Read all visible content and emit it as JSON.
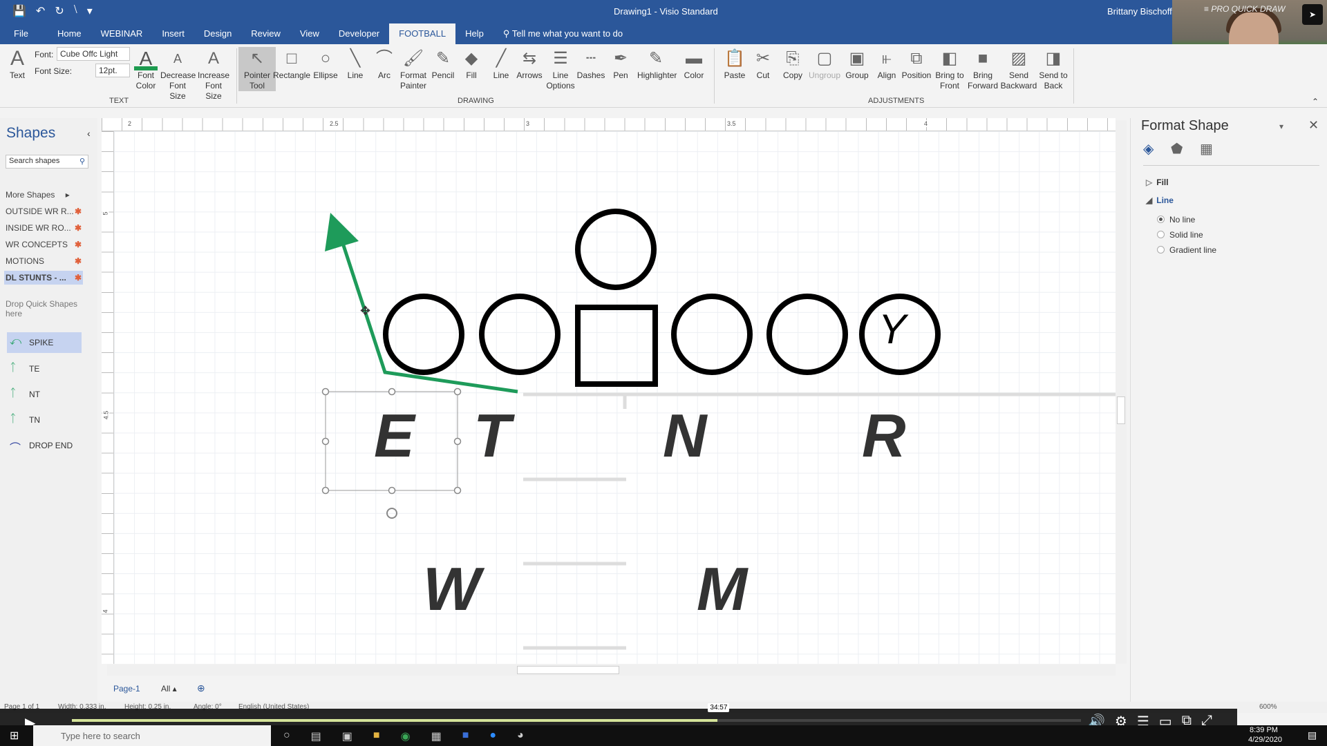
{
  "window": {
    "title": "Drawing1  -  Visio Standard",
    "user": "Brittany Bischoff"
  },
  "tabs": [
    "File",
    "Home",
    "WEBINAR",
    "Insert",
    "Design",
    "Review",
    "View",
    "Developer",
    "FOOTBALL",
    "Help"
  ],
  "active_tab": "FOOTBALL",
  "tell_me": "Tell me what you want to do",
  "ribbon": {
    "text_group": {
      "label": "TEXT",
      "text_btn": "Text",
      "font_label": "Font:",
      "font_value": "Cube Offc Light",
      "size_label": "Font Size:",
      "size_value": "12pt.",
      "font_color": "Font Color",
      "decrease": "Decrease Font Size",
      "increase": "Increase Font Size",
      "font_color_hex": "#1e9b50"
    },
    "drawing_group": {
      "label": "DRAWING",
      "buttons": [
        "Pointer Tool",
        "Rectangle",
        "Ellipse",
        "Line",
        "Arc",
        "Format Painter",
        "Pencil",
        "Fill",
        "Line",
        "Arrows",
        "Line Options",
        "Dashes",
        "Pen",
        "Highlighter",
        "Color"
      ]
    },
    "adjust_group": {
      "label": "ADJUSTMENTS",
      "buttons": [
        "Paste",
        "Cut",
        "Copy",
        "Ungroup",
        "Group",
        "Align",
        "Position",
        "Bring to Front",
        "Bring Forward",
        "Send Backward",
        "Send to Back"
      ]
    }
  },
  "webcam": {
    "logo": "PRO QUICK DRAW"
  },
  "shapes_panel": {
    "title": "Shapes",
    "search_placeholder": "Search shapes",
    "more": "More Shapes",
    "stencils": [
      "OUTSIDE WR R...",
      "INSIDE WR RO...",
      "WR CONCEPTS",
      "MOTIONS",
      "DL STUNTS - ..."
    ],
    "active_stencil": "DL STUNTS - ...",
    "drop_hint": "Drop Quick Shapes here",
    "quick_shapes": [
      "SPIKE",
      "TE",
      "NT",
      "TN",
      "DROP END"
    ],
    "selected_shape": "SPIKE"
  },
  "rulers": {
    "top": [
      "2",
      "2.5",
      "3",
      "3.5",
      "4"
    ],
    "left": [
      "5",
      "4.5",
      "4"
    ]
  },
  "drawing": {
    "offense_top_label": "",
    "receiver_label": "Y",
    "defense_labels": [
      "E",
      "T",
      "N",
      "R"
    ],
    "linebacker_labels": [
      "W",
      "M"
    ],
    "route_color": "#1e9b5a"
  },
  "format_shape": {
    "title": "Format Shape",
    "sections": [
      "Fill",
      "Line"
    ],
    "line_options": [
      "No line",
      "Solid line",
      "Gradient line"
    ],
    "selected": "No line"
  },
  "page_tabs": {
    "page": "Page-1",
    "all": "All"
  },
  "status": {
    "page": "Page 1 of 1",
    "width": "Width: 0.333 in.",
    "height": "Height: 0.25 in.",
    "angle": "Angle: 0°",
    "language": "English (United States)",
    "zoom": "600%"
  },
  "video": {
    "time": "34:57",
    "progress": 0.64
  },
  "taskbar": {
    "search": "Type here to search",
    "time": "8:39 PM",
    "date": "4/29/2020"
  }
}
